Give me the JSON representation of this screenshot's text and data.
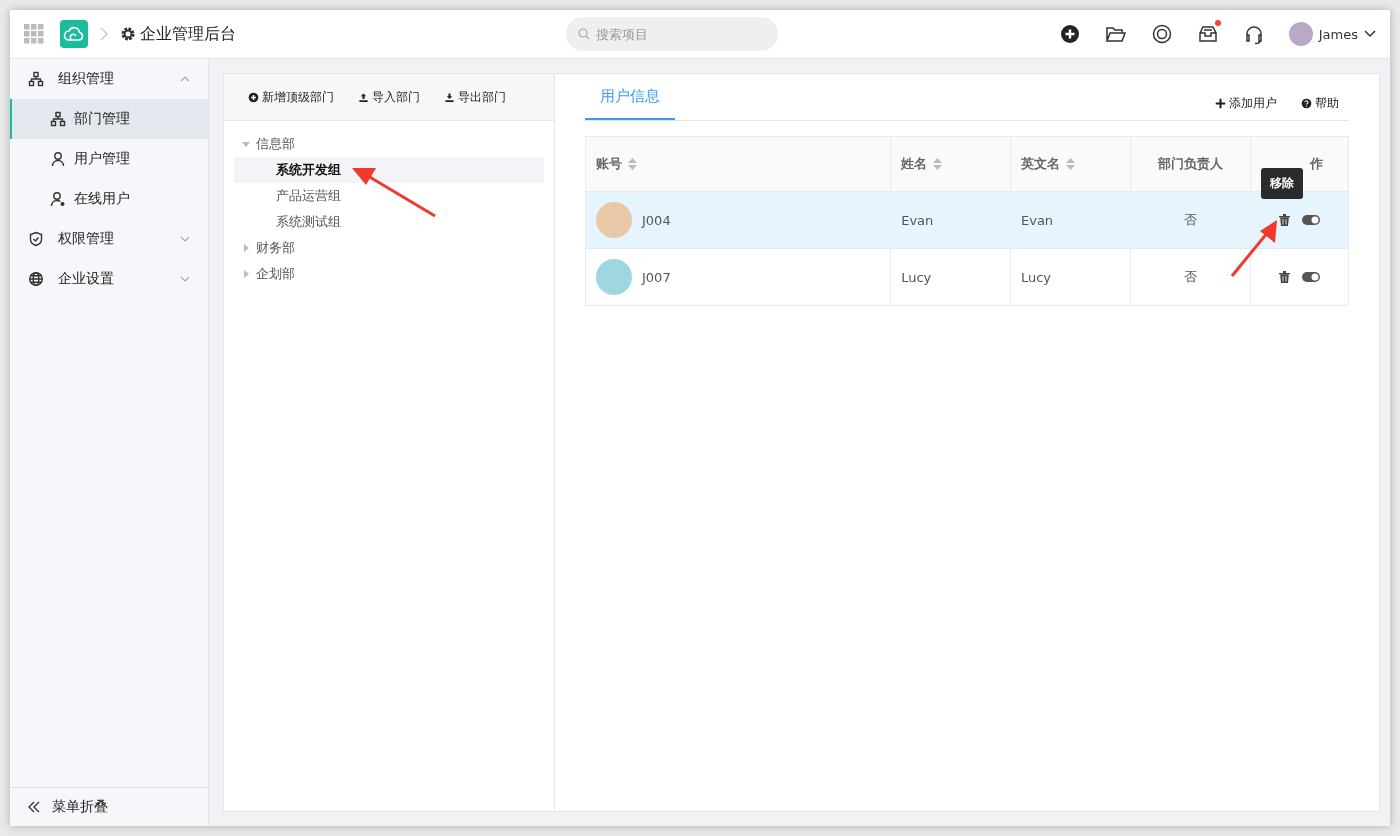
{
  "header": {
    "title": "企业管理后台",
    "search": {
      "placeholder": "搜索项目"
    },
    "notification_dot": true,
    "user": "James"
  },
  "sidebar": {
    "groups": [
      {
        "label": "组织管理",
        "expanded": true,
        "children": [
          {
            "label": "部门管理",
            "selected": true
          },
          {
            "label": "用户管理",
            "selected": false
          },
          {
            "label": "在线用户",
            "selected": false
          }
        ]
      },
      {
        "label": "权限管理",
        "expanded": false
      },
      {
        "label": "企业设置",
        "expanded": false
      }
    ],
    "collapse": "菜单折叠"
  },
  "tree_toolbar": [
    {
      "label": "新增顶级部门"
    },
    {
      "label": "导入部门"
    },
    {
      "label": "导出部门"
    }
  ],
  "tree": [
    {
      "label": "信息部",
      "expanded": true,
      "selected": false,
      "children": [
        {
          "label": "系统开发组",
          "selected": true
        },
        {
          "label": "产品运营组",
          "selected": false
        },
        {
          "label": "系统测试组",
          "selected": false
        }
      ]
    },
    {
      "label": "财务部",
      "expanded": false,
      "selected": false
    },
    {
      "label": "企划部",
      "expanded": false,
      "selected": false
    }
  ],
  "tabs": [
    {
      "label": "用户信息",
      "selected": true
    }
  ],
  "actions": [
    {
      "label": "添加用户"
    },
    {
      "label": "帮助"
    }
  ],
  "table": {
    "columns": [
      {
        "label": "账号",
        "sortable": true
      },
      {
        "label": "姓名",
        "sortable": true
      },
      {
        "label": "英文名",
        "sortable": true
      },
      {
        "label": "部门负责人",
        "sortable": false
      },
      {
        "label": "作",
        "sortable": false
      }
    ],
    "rows": [
      {
        "account": "J004",
        "name": "Evan",
        "english_name": "Evan",
        "department_head": "否",
        "selected": true
      },
      {
        "account": "J007",
        "name": "Lucy",
        "english_name": "Lucy",
        "department_head": "否",
        "selected": false
      }
    ]
  },
  "tooltip": "移除"
}
